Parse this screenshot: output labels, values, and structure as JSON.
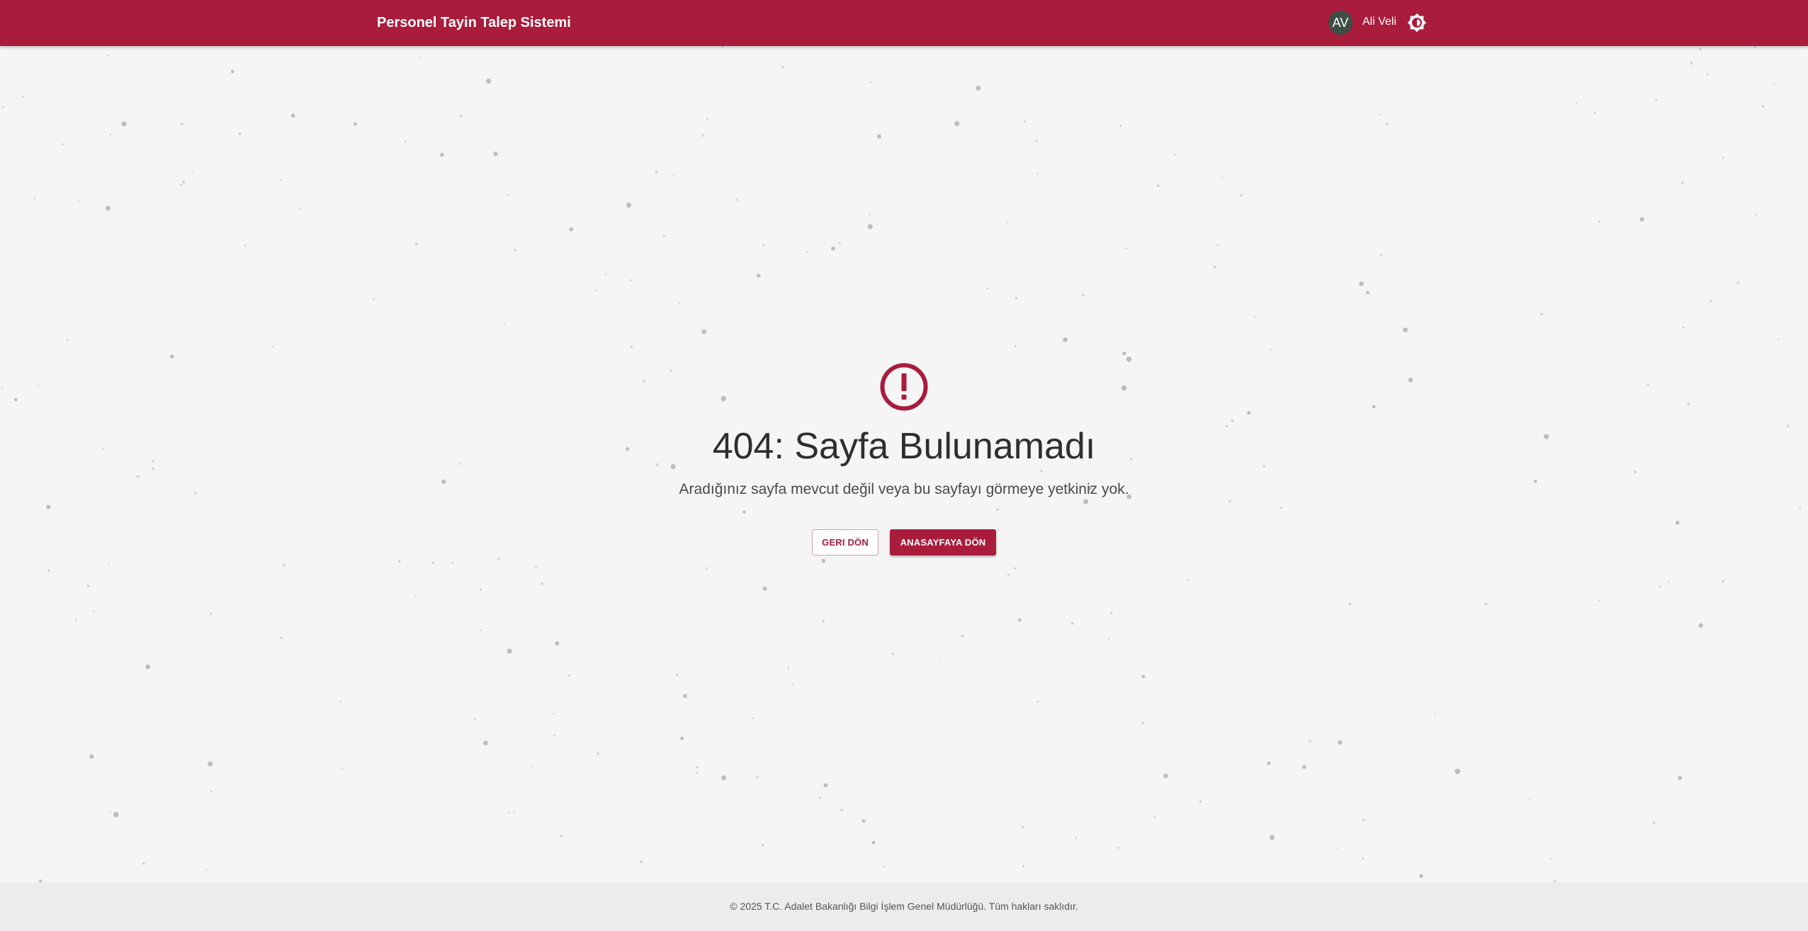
{
  "header": {
    "app_title": "Personel Tayin Talep Sistemi",
    "user_initials": "AV",
    "user_name": "Ali Veli",
    "theme_toggle_icon": "brightness-icon"
  },
  "main": {
    "icon": "error-exclamation-icon",
    "title": "404: Sayfa Bulunamadı",
    "description": "Aradığınız sayfa mevcut değil veya bu sayfayı görmeye yetkiniz yok.",
    "back_button_label": "GERI DÖN",
    "home_button_label": "ANASAYFAYA DÖN"
  },
  "footer": {
    "copyright": "© 2025 T.C. Adalet Bakanlığı Bilgi İşlem Genel Müdürlüğü. Tüm hakları saklıdır."
  },
  "colors": {
    "brand": "#a91c3b",
    "background": "#f5f5f5",
    "footer_background": "#ececec"
  }
}
